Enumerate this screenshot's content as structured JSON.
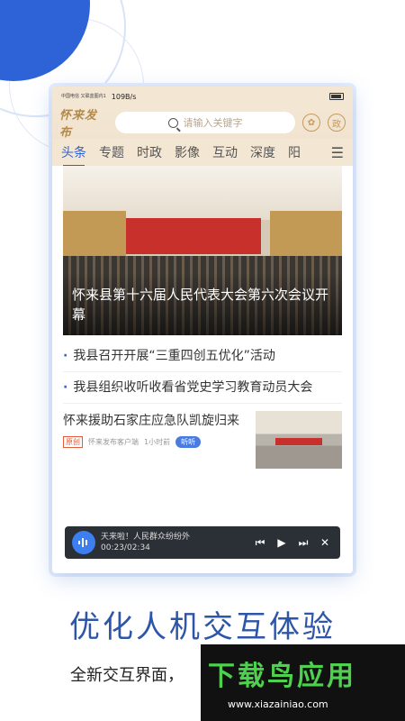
{
  "status_bar": {
    "carrier": "中国电信 又联蓝图内1",
    "speed": "109B/s"
  },
  "header": {
    "logo": "怀来发布",
    "search_placeholder": "请输入关键字",
    "right_icon_label": "政"
  },
  "tabs": [
    {
      "label": "头条",
      "active": true
    },
    {
      "label": "专题"
    },
    {
      "label": "时政"
    },
    {
      "label": "影像"
    },
    {
      "label": "互动"
    },
    {
      "label": "深度"
    },
    {
      "label": "阳"
    }
  ],
  "hero": {
    "title": "怀来县第十六届人民代表大会第六次会议开幕"
  },
  "news": [
    {
      "title": "我县召开开展“三重四创五优化”活动"
    },
    {
      "title": "我县组织收听收看省党史学习教育动员大会"
    }
  ],
  "feature": {
    "title": "怀来援助石家庄应急队凯旋归来",
    "badge": "原创",
    "source": "怀来发布客户端",
    "time": "1小时前",
    "listen_label": "听听"
  },
  "player": {
    "track": "天来啦！人民群众纷纷外",
    "time": "00:23/02:34"
  },
  "slogan": "优化人机交互体验",
  "subtitle": "全新交互界面，",
  "watermark": {
    "title": "下载鸟应用",
    "url": "www.xiazainiao.com"
  },
  "colors": {
    "accent": "#2d63d6",
    "header_bg": "#f3e6d3",
    "watermark_green": "#4fd14f"
  }
}
